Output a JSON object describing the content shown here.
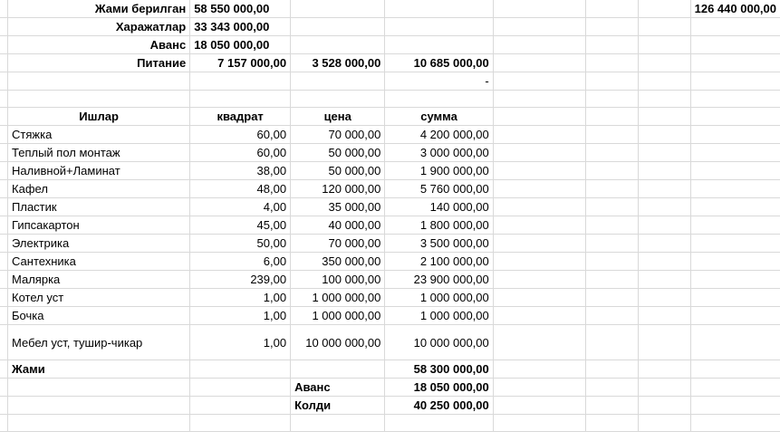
{
  "summary": [
    {
      "label": "Жами берилган",
      "value": "58 550 000,00",
      "extra": "126 440 000,00"
    },
    {
      "label": "Харажатлар",
      "value": "33 343 000,00"
    },
    {
      "label": "Аванс",
      "value": "18 050 000,00"
    },
    {
      "label": "Питание",
      "value": "7 157 000,00",
      "c2": "3 528 000,00",
      "c3": "10 685 000,00"
    }
  ],
  "dash": "-",
  "headers": {
    "works": "Ишлар",
    "area": "квадрат",
    "price": "цена",
    "sum": "сумма"
  },
  "rows": [
    {
      "name": "Стяжка",
      "area": "60,00",
      "price": "70 000,00",
      "sum": "4 200 000,00"
    },
    {
      "name": "Теплый пол монтаж",
      "area": "60,00",
      "price": "50 000,00",
      "sum": "3 000 000,00"
    },
    {
      "name": "Наливной+Ламинат",
      "area": "38,00",
      "price": "50 000,00",
      "sum": "1 900 000,00"
    },
    {
      "name": "Кафел",
      "area": "48,00",
      "price": "120 000,00",
      "sum": "5 760 000,00"
    },
    {
      "name": "Пластик",
      "area": "4,00",
      "price": "35 000,00",
      "sum": "140 000,00"
    },
    {
      "name": "Гипсакартон",
      "area": "45,00",
      "price": "40 000,00",
      "sum": "1 800 000,00"
    },
    {
      "name": "Электрика",
      "area": "50,00",
      "price": "70 000,00",
      "sum": "3 500 000,00"
    },
    {
      "name": "Сантехника",
      "area": "6,00",
      "price": "350 000,00",
      "sum": "2 100 000,00"
    },
    {
      "name": "Малярка",
      "area": "239,00",
      "price": "100 000,00",
      "sum": "23 900 000,00"
    },
    {
      "name": "Котел уст",
      "area": "1,00",
      "price": "1 000 000,00",
      "sum": "1 000 000,00"
    },
    {
      "name": "Бочка",
      "area": "1,00",
      "price": "1 000 000,00",
      "sum": "1 000 000,00"
    },
    {
      "name": "Мебел уст, тушир-чикар",
      "area": "1,00",
      "price": "10 000 000,00",
      "sum": "10 000 000,00"
    }
  ],
  "totals": {
    "total_label": "Жами",
    "total_sum": "58 300 000,00",
    "avans_label": "Аванс",
    "avans_sum": "18 050 000,00",
    "left_label": "Колди",
    "left_sum": "40 250 000,00"
  }
}
